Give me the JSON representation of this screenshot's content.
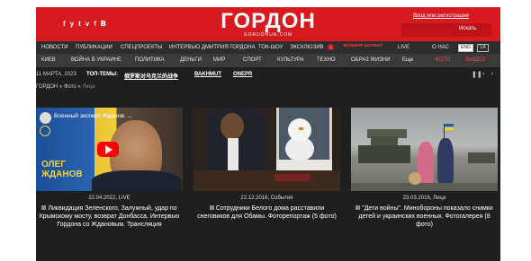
{
  "header": {
    "social": [
      "f",
      "y",
      "t",
      "v",
      "f",
      "𝐁"
    ],
    "logo_name": "ГОРДОН",
    "logo_url": "GORDONUA.COM",
    "login_link": "Вход или регистрация",
    "search_placeholder": "",
    "search_button": "Искать"
  },
  "nav_primary": [
    "НОВОСТИ",
    "ПУБЛИКАЦИИ",
    "СПЕЦПРОЕКТЫ",
    "ИНТЕРВЬЮ ДМИТРИЯ ГОРДОНА",
    "ТОК-ШОУ",
    "ЭКСКЛЮЗИВ",
    "ЖИЗНЬ ЗВЕЗД",
    "LIVE",
    "О НАС",
    "ENG",
    "UA"
  ],
  "nav_primary_badge": "1",
  "nav_primary_brand": "БУЛЬВАР ШОУБИЗ",
  "nav_secondary": [
    "КИЕВ",
    "ВОЙНА В УКРАИНЕ",
    "ПОЛИТИКА",
    "ДЕНЬГИ",
    "МИР",
    "СПОРТ",
    "КУЛЬТУРА",
    "ТЕХНО",
    "ОБРАЗ ЖИЗНИ",
    "Еще"
  ],
  "nav_secondary_red": [
    "ФОТО",
    "ВИДЕО"
  ],
  "topbar": {
    "date": "11 МАРТА, 2023",
    "top_label": "ТОП-ТЕМЫ:",
    "themes": [
      "俄罗斯对乌克兰的战争",
      "ВАKHMUT",
      "ONEPR"
    ]
  },
  "breadcrumb": [
    "ГОРДОН",
    "Фото",
    "Лица"
  ],
  "cards": [
    {
      "video_title": "Военный эксперт Жданов. ...",
      "caption_line1": "ОЛЕГ",
      "caption_line2": "ЖДАНОВ",
      "meta": "22.04.2022, LIVE",
      "title": "Ликвидация Зеленского, Залужный, удар по Крымскому мосту, возврат Донбасса. Интервью Гордона со Ждановым. Трансляция"
    },
    {
      "meta": "22.12.2016, События",
      "title": "Сотрудники Белого дома расставили снеговиков для Обамы. Фоторепортаж (5 фото)"
    },
    {
      "meta": "23.03.2016, Лица",
      "title": "\"Дети войны\". Минобороны показало снимки детей и украинских военных. Фотогалерея (8 фото)"
    }
  ],
  "colors": {
    "brand_red": "#d71920",
    "page_dark": "#1f1f1f",
    "nav_bg": "#2d2d2d"
  }
}
